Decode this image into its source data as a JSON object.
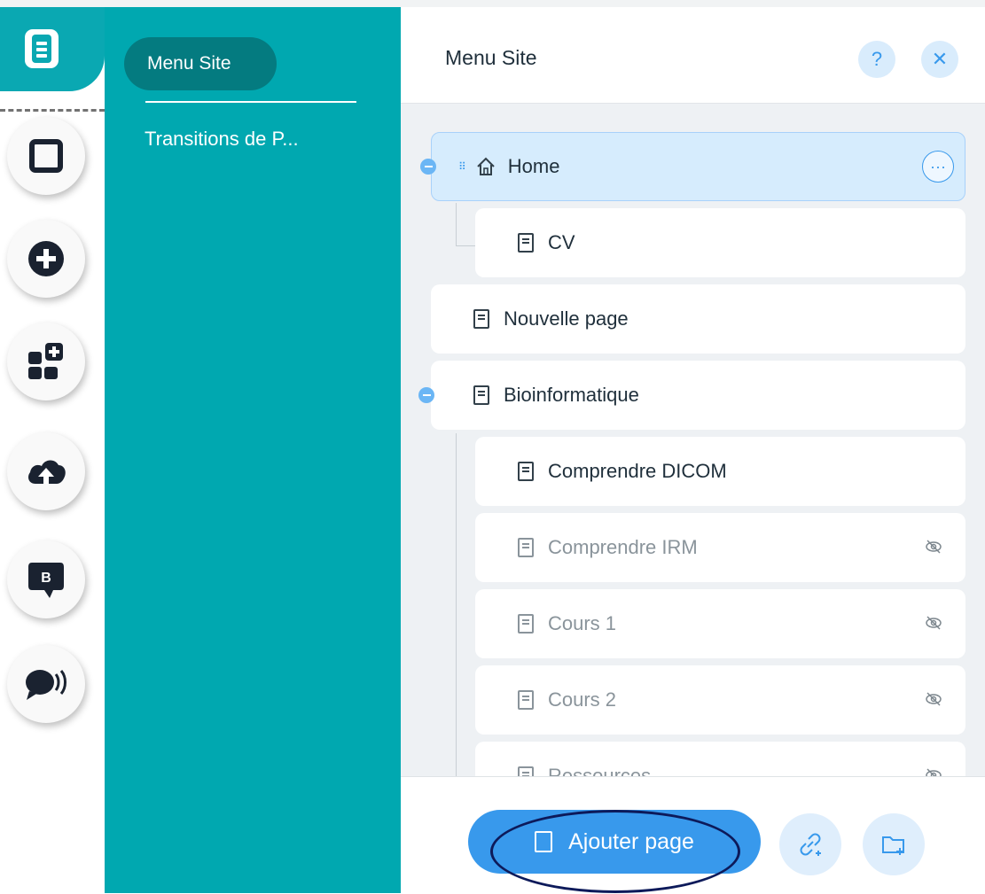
{
  "sidebar": {
    "active_menu": "Menu Site",
    "items": [
      {
        "label": "Transitions de P..."
      }
    ]
  },
  "panel": {
    "title": "Menu Site",
    "help_label": "?",
    "close_label": "✕",
    "pages": [
      {
        "label": "Home",
        "type": "home",
        "level": 0,
        "selected": true
      },
      {
        "label": "CV",
        "type": "page",
        "level": 1
      },
      {
        "label": "Nouvelle page",
        "type": "page",
        "level": 0
      },
      {
        "label": "Bioinformatique",
        "type": "page",
        "level": 0
      },
      {
        "label": "Comprendre DICOM",
        "type": "page",
        "level": 1
      },
      {
        "label": "Comprendre IRM",
        "type": "page",
        "level": 1,
        "hidden": true
      },
      {
        "label": "Cours 1",
        "type": "page",
        "level": 1,
        "hidden": true
      },
      {
        "label": "Cours 2",
        "type": "page",
        "level": 1,
        "hidden": true
      },
      {
        "label": "Ressources",
        "type": "page",
        "level": 1,
        "hidden": true
      }
    ],
    "footer": {
      "add_page_label": "Ajouter page"
    }
  },
  "colors": {
    "teal": "#00a8b0",
    "accent_blue": "#3899ec",
    "selected_row": "#d6ecfd"
  }
}
